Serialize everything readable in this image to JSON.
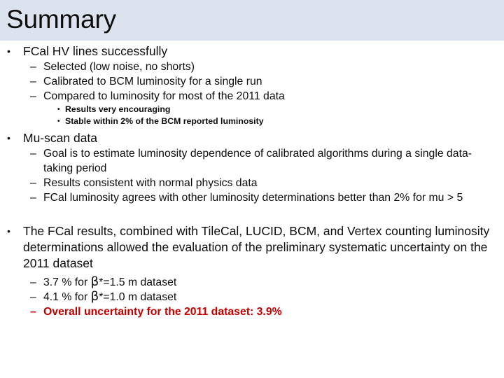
{
  "slide": {
    "title": "Summary",
    "title_band_color": "#dce3ef",
    "text_color": "#0d0d0d",
    "accent_color": "#c00000",
    "background_color": "#ffffff",
    "bullet_marker_level1": "•",
    "bullet_marker_level2": "–",
    "bullet_marker_level3": "•"
  },
  "content": {
    "section1": {
      "heading": "FCal HV lines successfully",
      "sub": [
        "Selected (low noise, no shorts)",
        "Calibrated to BCM luminosity for a single run",
        "Compared to luminosity for most of the 2011 data"
      ],
      "subsub": [
        "Results very encouraging",
        "Stable within 2% of the BCM reported luminosity"
      ]
    },
    "section2": {
      "heading": "Mu-scan data",
      "sub": [
        "Goal is to estimate luminosity dependence of calibrated algorithms during a single data-taking period",
        "Results consistent with normal physics data",
        "FCal luminosity agrees with other luminosity determinations better than 2% for mu > 5"
      ]
    },
    "section3": {
      "heading": "The FCal results, combined with TileCal, LUCID, BCM, and Vertex counting luminosity determinations allowed the evaluation of the preliminary systematic uncertainty on the 2011 dataset",
      "sub": [
        {
          "pre": "3.7 % for ",
          "beta": "β",
          "post": "*=1.5 m dataset",
          "emphasis": false
        },
        {
          "pre": "4.1 % for ",
          "beta": "β",
          "post": "*=1.0 m dataset",
          "emphasis": false
        },
        {
          "pre": "Overall uncertainty for the 2011 dataset: 3.9%",
          "beta": "",
          "post": "",
          "emphasis": true
        }
      ]
    }
  }
}
